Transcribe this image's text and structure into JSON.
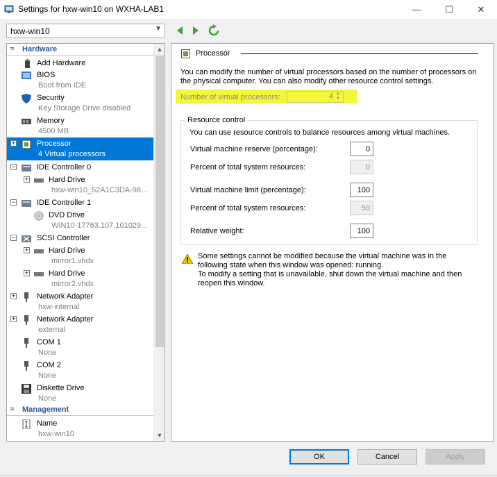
{
  "window": {
    "title": "Settings for hxw-win10 on WXHA-LAB1",
    "minimize": "—",
    "maximize": "☐",
    "close": "✕"
  },
  "vm_selector": {
    "value": "hxw-win10"
  },
  "sidebar": {
    "hardware_header": "Hardware",
    "management_header": "Management",
    "items": [
      {
        "label": "Add Hardware",
        "sub": ""
      },
      {
        "label": "BIOS",
        "sub": "Boot from IDE"
      },
      {
        "label": "Security",
        "sub": "Key Storage Drive disabled"
      },
      {
        "label": "Memory",
        "sub": "4500 MB"
      },
      {
        "label": "Processor",
        "sub": "4 Virtual processors"
      },
      {
        "label": "IDE Controller 0",
        "sub": ""
      },
      {
        "label": "Hard Drive",
        "sub": "hxw-win10_52A1C3DA-98..."
      },
      {
        "label": "IDE Controller 1",
        "sub": ""
      },
      {
        "label": "DVD Drive",
        "sub": "WIN10-17763.107.101029..."
      },
      {
        "label": "SCSI Controller",
        "sub": ""
      },
      {
        "label": "Hard Drive",
        "sub": "mirror1.vhdx"
      },
      {
        "label": "Hard Drive",
        "sub": "mirror2.vhdx"
      },
      {
        "label": "Network Adapter",
        "sub": "hxw-internal"
      },
      {
        "label": "Network Adapter",
        "sub": "external"
      },
      {
        "label": "COM 1",
        "sub": "None"
      },
      {
        "label": "COM 2",
        "sub": "None"
      },
      {
        "label": "Diskette Drive",
        "sub": "None"
      },
      {
        "label": "Name",
        "sub": "hxw-win10"
      }
    ]
  },
  "processor": {
    "title": "Processor",
    "description": "You can modify the number of virtual processors based on the number of processors on the physical computer. You can also modify other resource control settings.",
    "num_vp_label": "Number of virtual processors:",
    "num_vp_value": "4",
    "resource_control": {
      "legend": "Resource control",
      "description": "You can use resource controls to balance resources among virtual machines.",
      "reserve_label": "Virtual machine reserve (percentage):",
      "reserve_value": "0",
      "reserve_pct_label": "Percent of total system resources:",
      "reserve_pct_value": "0",
      "limit_label": "Virtual machine limit (percentage):",
      "limit_value": "100",
      "limit_pct_label": "Percent of total system resources:",
      "limit_pct_value": "50",
      "weight_label": "Relative weight:",
      "weight_value": "100"
    },
    "warning_line1": "Some settings cannot be modified because the virtual machine was in the following state when this window was opened: running.",
    "warning_line2": "To modify a setting that is unavailable, shut down the virtual machine and then reopen this window."
  },
  "buttons": {
    "ok": "OK",
    "cancel": "Cancel",
    "apply": "Apply"
  },
  "colors": {
    "selection": "#0078d7",
    "highlight": "#f4f63a",
    "header_blue": "#2b5797"
  }
}
